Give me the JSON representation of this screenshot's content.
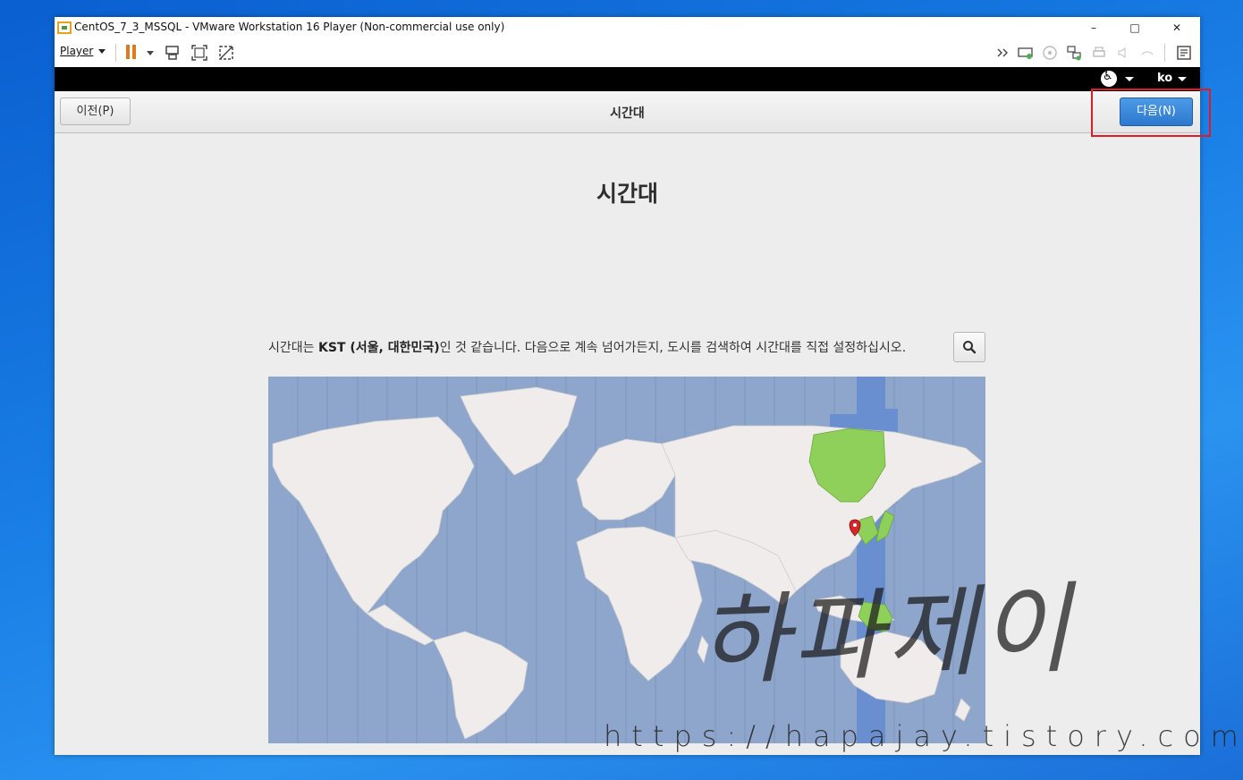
{
  "window": {
    "title": "CentOS_7_3_MSSQL - VMware Workstation 16 Player (Non-commercial use only)",
    "minimize": "–",
    "maximize": "□",
    "close": "✕"
  },
  "toolbar": {
    "player_label": "Player"
  },
  "guest_topbar": {
    "language": "ko"
  },
  "installer": {
    "back_label": "이전(P)",
    "header_title": "시간대",
    "next_label": "다음(N)",
    "page_title": "시간대",
    "message_pre": "시간대는 ",
    "message_bold": "KST (서울, 대한민국)",
    "message_post": "인 것 같습니다. 다음으로 계속 넘어가든지, 도시를 검색하여 시간대를 직접 설정하십시오."
  },
  "colors": {
    "map_ocean": "#8fa6cc",
    "map_land": "#efeceb",
    "highlight_zone": "#6a8fd0",
    "selected_land": "#8fd05a",
    "next_button": "#3b86da",
    "highlight_box": "#e01b24"
  },
  "watermark": {
    "korean": "하파제이",
    "url": "https://hapajay.tistory.com/"
  }
}
